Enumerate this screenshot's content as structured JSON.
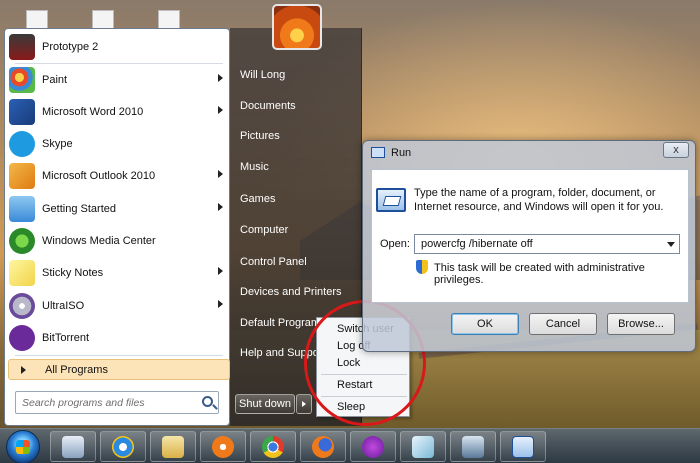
{
  "start_menu": {
    "programs": [
      {
        "label": "Prototype 2",
        "icon": "prototype2-icon",
        "has_submenu": false
      },
      {
        "label": "Paint",
        "icon": "paint-icon",
        "has_submenu": true
      },
      {
        "label": "Microsoft Word 2010",
        "icon": "word-icon",
        "has_submenu": true
      },
      {
        "label": "Skype",
        "icon": "skype-icon",
        "has_submenu": false
      },
      {
        "label": "Microsoft Outlook 2010",
        "icon": "outlook-icon",
        "has_submenu": true
      },
      {
        "label": "Getting Started",
        "icon": "getting-started-icon",
        "has_submenu": true
      },
      {
        "label": "Windows Media Center",
        "icon": "media-center-icon",
        "has_submenu": false
      },
      {
        "label": "Sticky Notes",
        "icon": "sticky-notes-icon",
        "has_submenu": true
      },
      {
        "label": "UltraISO",
        "icon": "ultraiso-icon",
        "has_submenu": true
      },
      {
        "label": "BitTorrent",
        "icon": "bittorrent-icon",
        "has_submenu": false
      }
    ],
    "all_programs": "All Programs",
    "search_placeholder": "Search programs and files",
    "right_items": [
      "Will Long",
      "Documents",
      "Pictures",
      "Music",
      "Games",
      "Computer",
      "Control Panel",
      "Devices and Printers",
      "Default Program",
      "Help and Suppo"
    ],
    "shutdown_label": "Shut down"
  },
  "shutdown_submenu": {
    "items": [
      "Switch user",
      "Log off",
      "Lock",
      "Restart",
      "Sleep"
    ]
  },
  "run_dialog": {
    "title": "Run",
    "close": "x",
    "description": "Type the name of a program, folder, document, or Internet resource, and Windows will open it for you.",
    "open_label": "Open:",
    "open_value": "powercfg /hibernate off",
    "admin_note": "This task will be created with administrative privileges.",
    "ok": "OK",
    "cancel": "Cancel",
    "browse": "Browse..."
  },
  "taskbar": {
    "apps": [
      "calculator-icon",
      "internet-explorer-icon",
      "windows-explorer-icon",
      "media-player-icon",
      "chrome-icon",
      "firefox-icon",
      "messenger-icon",
      "notepad-icon",
      "device-icon",
      "run-icon"
    ]
  },
  "colors": {
    "highlight_circle": "#d9181a",
    "all_programs_bg": "#fde3b8"
  }
}
